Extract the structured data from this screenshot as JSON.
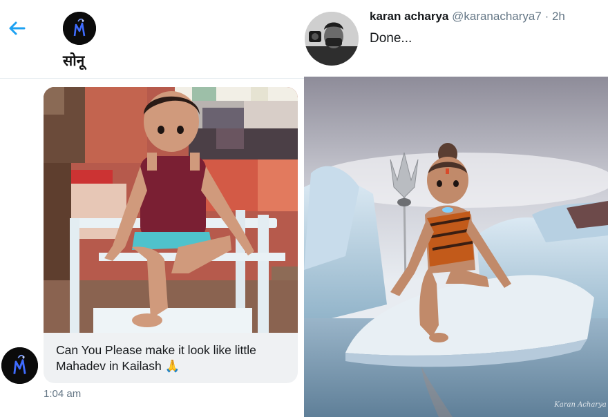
{
  "dm": {
    "contact_name": "सोनू",
    "message_text": "Can You Please make it look like little Mahadev in Kailash 🙏",
    "message_time": "1:04 am"
  },
  "tweet": {
    "author_name": "karan acharya",
    "author_handle": "@karanacharya7",
    "separator": "·",
    "time": "2h",
    "text": "Done...",
    "image_watermark": "Karan Acharya"
  },
  "colors": {
    "accent": "#1da1f2",
    "bubble": "#eff1f3",
    "muted": "#657786",
    "divider": "#e6ecf0"
  },
  "icons": {
    "back": "arrow-left-icon",
    "avatar_logo": "mahadev-logo-icon"
  }
}
